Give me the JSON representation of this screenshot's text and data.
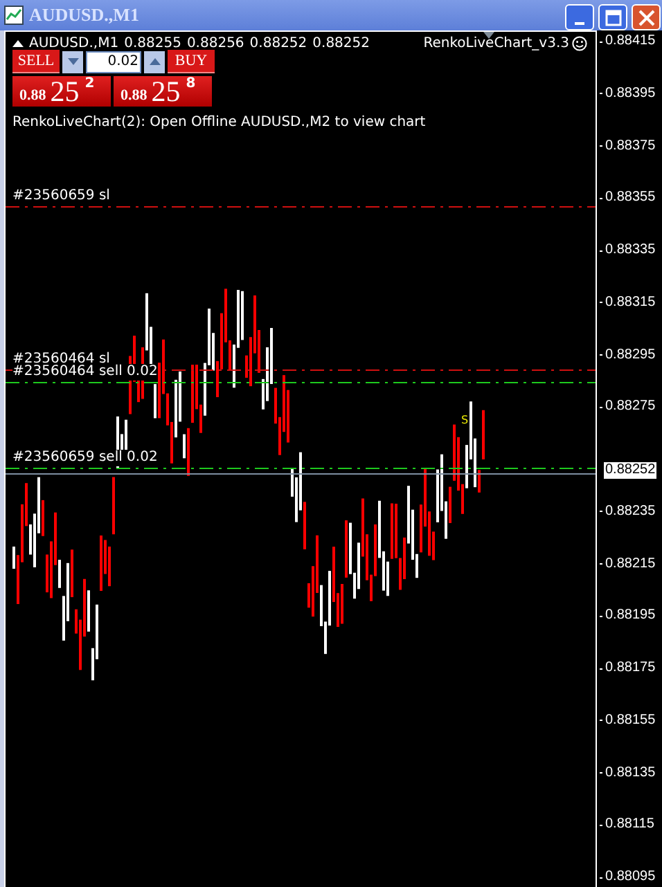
{
  "window": {
    "title": "AUDUSD.,M1"
  },
  "chart_header": {
    "symbol": "AUDUSD.,M1",
    "quotes": [
      "0.88255",
      "0.88256",
      "0.88252",
      "0.88252"
    ],
    "indicator": "RenkoLiveChart_v3.3"
  },
  "trade_panel": {
    "sell_label": "SELL",
    "buy_label": "BUY",
    "lot": "0.02",
    "bid": {
      "big": "0.88",
      "pips": "25",
      "fraction": "2"
    },
    "ask": {
      "big": "0.88",
      "pips": "25",
      "fraction": "8"
    }
  },
  "message": "RenkoLiveChart(2): Open Offline AUDUSD.,M2 to view chart",
  "order_lines": [
    {
      "label": "#23560659 sl",
      "kind": "sl"
    },
    {
      "label": "#23560464 sl",
      "kind": "sl"
    },
    {
      "label": "#23560464 sell 0.02",
      "kind": "order"
    },
    {
      "label": "#23560659 sell 0.02",
      "kind": "order"
    }
  ],
  "signal_marker": "S",
  "price_axis": {
    "ticks": [
      "0.88415",
      "0.88395",
      "0.88375",
      "0.88355",
      "0.88335",
      "0.88315",
      "0.88295",
      "0.88275",
      "0.88235",
      "0.88215",
      "0.88195",
      "0.88175",
      "0.88155",
      "0.88135",
      "0.88115",
      "0.88095"
    ],
    "current": "0.88252"
  }
}
